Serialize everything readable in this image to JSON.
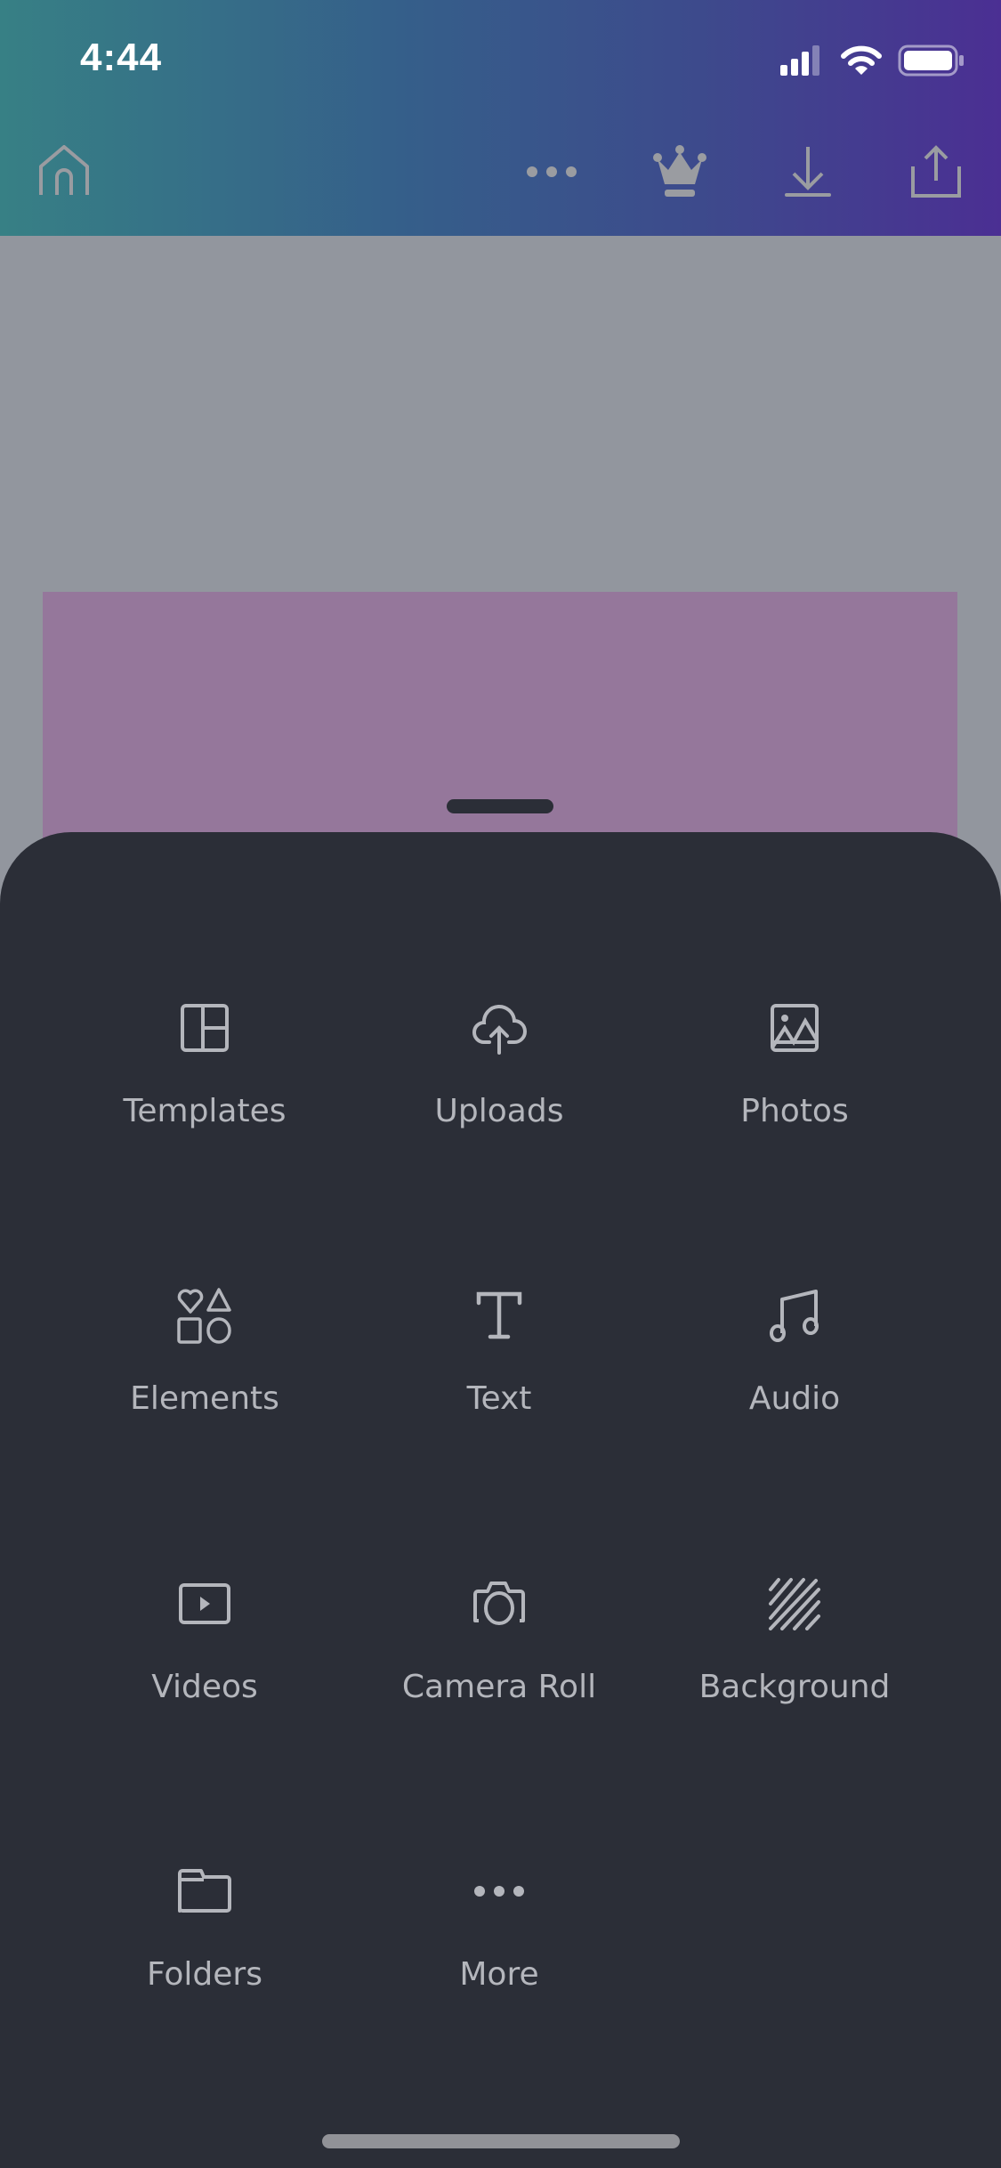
{
  "status_bar": {
    "time": "4:44",
    "icons": [
      "cellular-signal-icon",
      "wifi-icon",
      "battery-icon"
    ]
  },
  "toolbar": {
    "home": "home-icon",
    "more": "more-dots-icon",
    "premium": "crown-icon",
    "download": "download-icon",
    "share": "share-icon"
  },
  "canvas": {
    "page_color": "#95779b",
    "background_color": "#92969e"
  },
  "sheet": {
    "background_color": "#2b2e37",
    "items": [
      {
        "label": "Templates",
        "icon": "templates-icon"
      },
      {
        "label": "Uploads",
        "icon": "cloud-upload-icon"
      },
      {
        "label": "Photos",
        "icon": "photo-icon"
      },
      {
        "label": "Elements",
        "icon": "shapes-icon"
      },
      {
        "label": "Text",
        "icon": "text-icon"
      },
      {
        "label": "Audio",
        "icon": "music-note-icon"
      },
      {
        "label": "Videos",
        "icon": "video-play-icon"
      },
      {
        "label": "Camera Roll",
        "icon": "camera-icon"
      },
      {
        "label": "Background",
        "icon": "background-stripes-icon"
      },
      {
        "label": "Folders",
        "icon": "folder-icon"
      },
      {
        "label": "More",
        "icon": "more-dots-icon"
      }
    ]
  }
}
